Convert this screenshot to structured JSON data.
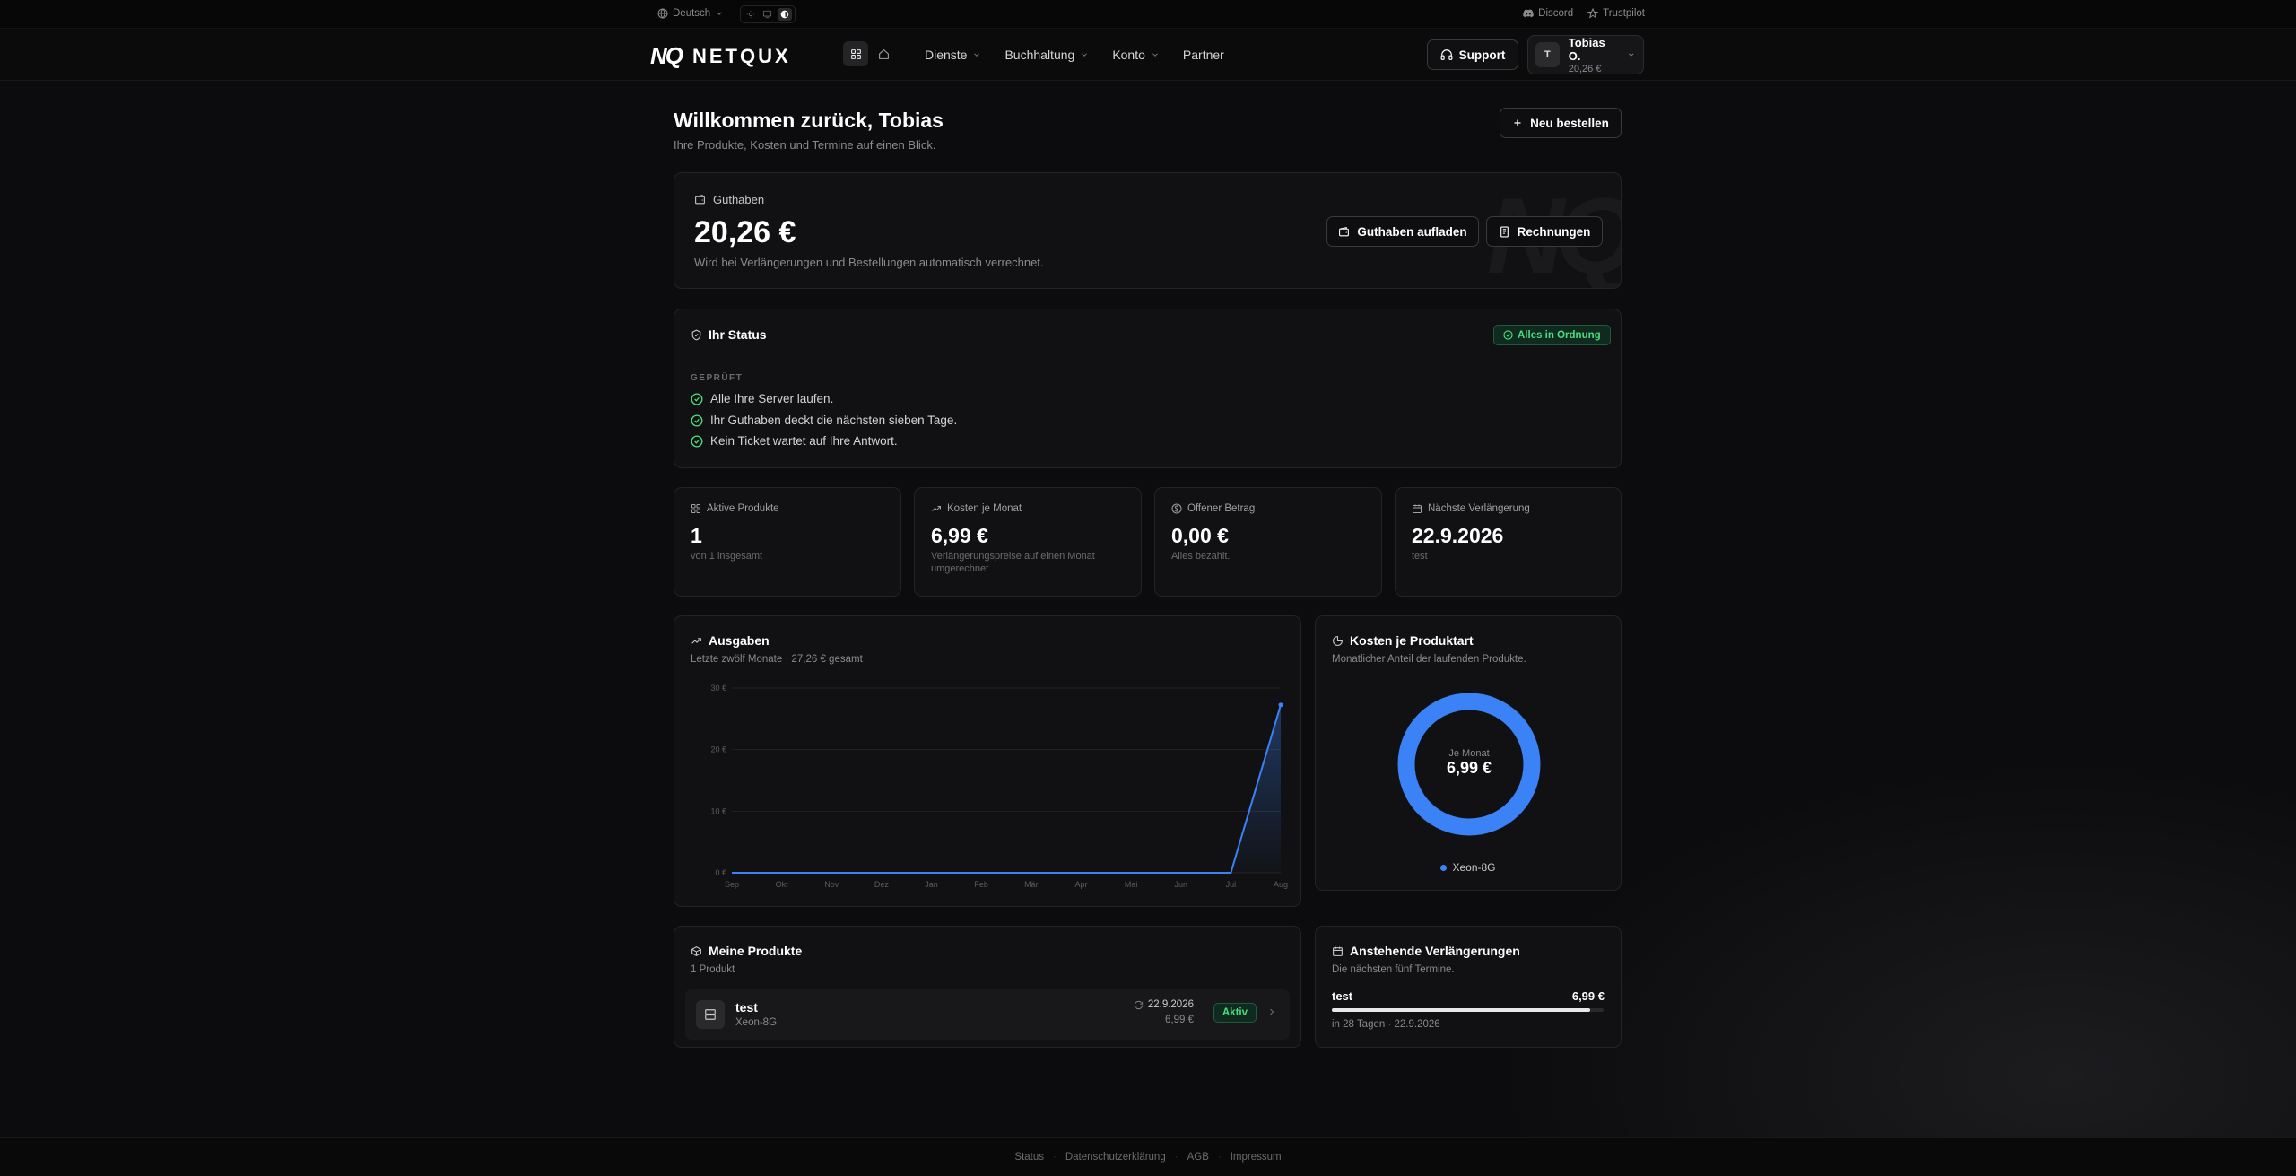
{
  "topbar": {
    "language": "Deutsch",
    "discord": "Discord",
    "trustpilot": "Trustpilot"
  },
  "nav": {
    "logo_mark": "NQ",
    "logo_text": "NETQUX",
    "menu": [
      "Dienste",
      "Buchhaltung",
      "Konto",
      "Partner"
    ],
    "support": "Support",
    "user": {
      "initial": "T",
      "name": "Tobias O.",
      "balance": "20,26 €"
    }
  },
  "header": {
    "title": "Willkommen zurück, Tobias",
    "subtitle": "Ihre Produkte, Kosten und Termine auf einen Blick.",
    "new_order": "Neu bestellen"
  },
  "balance": {
    "label": "Guthaben",
    "value": "20,26 €",
    "note": "Wird bei Verlängerungen und Bestellungen automatisch verrechnet.",
    "topup": "Guthaben aufladen",
    "invoices": "Rechnungen",
    "watermark": "NQ"
  },
  "status": {
    "title": "Ihr Status",
    "badge": "Alles in Ordnung",
    "checked_label": "GEPRÜFT",
    "checks": [
      "Alle Ihre Server laufen.",
      "Ihr Guthaben deckt die nächsten sieben Tage.",
      "Kein Ticket wartet auf Ihre Antwort."
    ]
  },
  "stats": [
    {
      "label": "Aktive Produkte",
      "value": "1",
      "note": "von 1 insgesamt",
      "icon": "grid-icon"
    },
    {
      "label": "Kosten je Monat",
      "value": "6,99 €",
      "note": "Verlängerungspreise auf einen Monat umgerechnet",
      "icon": "trend-icon"
    },
    {
      "label": "Offener Betrag",
      "value": "0,00 €",
      "note": "Alles bezahlt.",
      "icon": "coin-icon"
    },
    {
      "label": "Nächste Verlängerung",
      "value": "22.9.2026",
      "note": "test",
      "icon": "calendar-icon"
    }
  ],
  "spending": {
    "title": "Ausgaben",
    "subtitle": "Letzte zwölf Monate · 27,26 € gesamt"
  },
  "chart_data": [
    {
      "type": "area",
      "title": "Ausgaben",
      "categories": [
        "Sep",
        "Okt",
        "Nov",
        "Dez",
        "Jan",
        "Feb",
        "Mär",
        "Apr",
        "Mai",
        "Jun",
        "Jul",
        "Aug"
      ],
      "values": [
        0,
        0,
        0,
        0,
        0,
        0,
        0,
        0,
        0,
        0,
        0,
        27.26
      ],
      "ylim": [
        0,
        30
      ],
      "yticks": [
        0,
        10,
        20,
        30
      ],
      "ytick_labels": [
        "0 €",
        "10 €",
        "20 €",
        "30 €"
      ],
      "grid": true,
      "color": "#3b82f6"
    },
    {
      "type": "pie",
      "title": "Kosten je Produktart",
      "subtitle": "Monatlicher Anteil der laufenden Produkte.",
      "center_label": "Je Monat",
      "center_value": "6,99 €",
      "slices": [
        {
          "name": "Xeon-8G",
          "value": 6.99,
          "color": "#3b82f6"
        }
      ]
    }
  ],
  "products": {
    "title": "Meine Produkte",
    "count": "1 Produkt",
    "items": [
      {
        "name": "test",
        "type": "Xeon-8G",
        "date": "22.9.2026",
        "price": "6,99 €",
        "status": "Aktiv"
      }
    ]
  },
  "renewals": {
    "title": "Anstehende Verlängerungen",
    "subtitle": "Die nächsten fünf Termine.",
    "items": [
      {
        "name": "test",
        "price": "6,99 €",
        "progress": 0.95,
        "note": "in 28 Tagen · 22.9.2026"
      }
    ]
  },
  "footer": [
    "Status",
    "Datenschutzerklärung",
    "AGB",
    "Impressum"
  ]
}
